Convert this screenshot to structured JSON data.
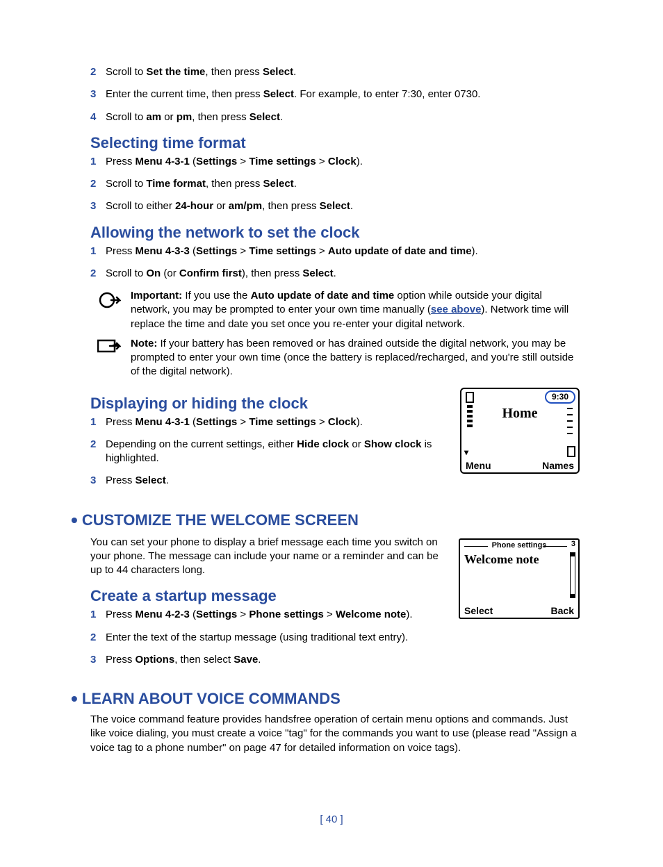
{
  "steps_top": [
    {
      "n": "2",
      "parts": [
        "Scroll to ",
        "Set the time",
        ", then press ",
        "Select",
        "."
      ]
    },
    {
      "n": "3",
      "parts": [
        "Enter the current time, then press ",
        "Select",
        ". For example, to enter 7:30, enter 0730."
      ]
    },
    {
      "n": "4",
      "parts": [
        "Scroll to ",
        "am",
        " or ",
        "pm",
        ", then press ",
        "Select",
        "."
      ]
    }
  ],
  "h_time_format": "Selecting time format",
  "steps_tf": [
    {
      "n": "1",
      "parts": [
        "Press ",
        "Menu 4-3-1",
        " (",
        "Settings",
        " > ",
        "Time settings",
        " > ",
        "Clock",
        ")."
      ]
    },
    {
      "n": "2",
      "parts": [
        "Scroll to ",
        "Time format",
        ", then press ",
        "Select",
        "."
      ]
    },
    {
      "n": "3",
      "parts": [
        "Scroll to either ",
        "24-hour",
        " or ",
        "am/pm",
        ", then press ",
        "Select",
        "."
      ]
    }
  ],
  "h_network": "Allowing the network to set the clock",
  "steps_net": [
    {
      "n": "1",
      "parts": [
        "Press ",
        "Menu 4-3-3",
        " (",
        "Settings",
        " > ",
        "Time settings",
        " > ",
        "Auto update of date and time",
        ")."
      ]
    },
    {
      "n": "2",
      "parts": [
        "Scroll to ",
        "On",
        " (or ",
        "Confirm first",
        "), then press ",
        "Select",
        "."
      ]
    }
  ],
  "important": {
    "label": "Important:",
    "pre": " If you use the ",
    "bold": "Auto update of date and time",
    "post1": " option while outside your digital network, you may be prompted to enter your own time manually (",
    "link": "see above",
    "post2": "). Network time will replace the time and date you set once you re-enter your digital network."
  },
  "note": {
    "label": "Note:",
    "text": " If your battery has been removed or has drained outside the digital network, you may be prompted to enter your own time (once the battery is replaced/recharged, and you're still outside of the digital network)."
  },
  "h_display": "Displaying or hiding the clock",
  "steps_disp": [
    {
      "n": "1",
      "parts": [
        "Press ",
        "Menu 4-3-1",
        " (",
        "Settings",
        " > ",
        "Time settings",
        " > ",
        "Clock",
        ")."
      ]
    },
    {
      "n": "2",
      "parts": [
        "Depending on the current settings, either ",
        "Hide clock",
        " or ",
        "Show clock",
        " is highlighted."
      ]
    },
    {
      "n": "3",
      "parts": [
        "Press ",
        "Select",
        "."
      ]
    }
  ],
  "phone1": {
    "time": "9:30",
    "home": "Home",
    "menu": "Menu",
    "names": "Names",
    "ant": "▾"
  },
  "h_customize": "CUSTOMIZE THE WELCOME SCREEN",
  "customize_para": "You can set your phone to display a brief message each time you switch on your phone. The message can include your name or a reminder and can be up to 44 characters long.",
  "h_create": "Create a startup message",
  "steps_create": [
    {
      "n": "1",
      "parts": [
        "Press ",
        "Menu 4-2-3",
        " (",
        "Settings",
        " > ",
        "Phone settings",
        " > ",
        "Welcome note",
        ")."
      ]
    },
    {
      "n": "2",
      "parts": [
        "Enter the text of the startup message (using traditional text entry)."
      ]
    },
    {
      "n": "3",
      "parts": [
        "Press ",
        "Options",
        ", then select ",
        "Save",
        "."
      ]
    }
  ],
  "phone2": {
    "head": "Phone settings",
    "num": "3",
    "title": "Welcome note",
    "select": "Select",
    "back": "Back"
  },
  "h_voice": "LEARN ABOUT VOICE COMMANDS",
  "voice_para": "The voice command feature provides handsfree operation of certain menu options and commands. Just like voice dialing, you must create a voice \"tag\" for the commands you want to use (please read \"Assign a voice tag to a phone number\" on page 47 for detailed information on voice tags).",
  "pagenum": "[ 40 ]"
}
